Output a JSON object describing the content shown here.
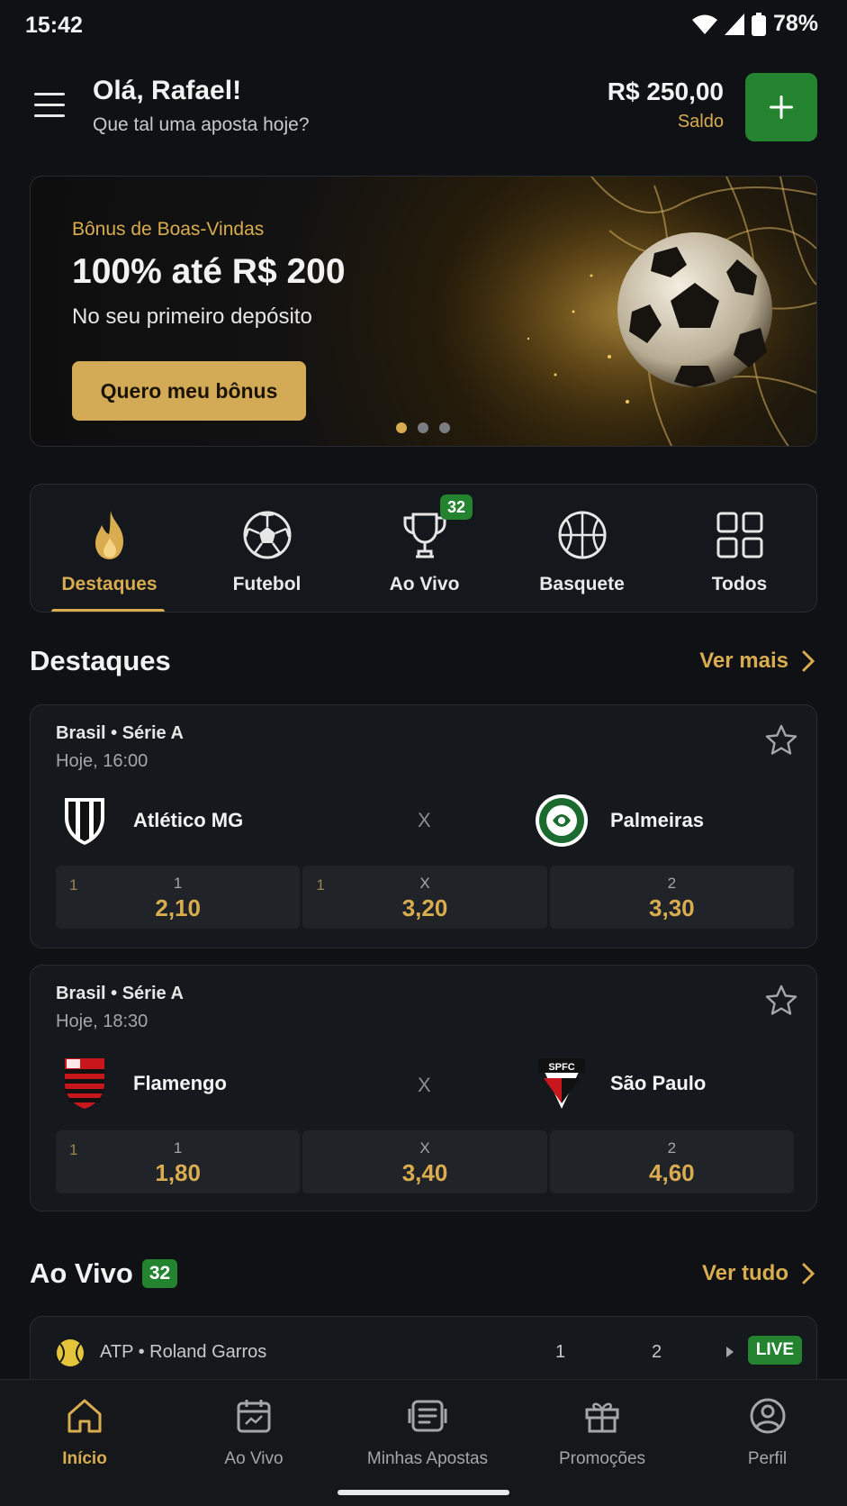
{
  "status_bar": {
    "time": "15:42",
    "battery": "78%"
  },
  "header": {
    "greeting": "Olá, Rafael!",
    "subtitle": "Que tal uma aposta hoje?",
    "balance_value": "R$ 250,00",
    "balance_label": "Saldo",
    "menu_icon": "hamburger-menu-icon",
    "deposit_icon": "plus-icon"
  },
  "banner": {
    "kicker": "Bônus de Boas-Vindas",
    "title": "100% até R$ 200",
    "subtitle": "No seu primeiro depósito",
    "cta": "Quero meu bônus",
    "slides": 3,
    "active_slide": 1
  },
  "categories": [
    {
      "label": "Destaques",
      "icon": "flame-icon",
      "active": true
    },
    {
      "label": "Futebol",
      "icon": "soccer-ball-icon",
      "active": false
    },
    {
      "label": "Ao Vivo",
      "icon": "trophy-icon",
      "active": false,
      "badge": "32"
    },
    {
      "label": "Basquete",
      "icon": "basketball-icon",
      "active": false
    },
    {
      "label": "Todos",
      "icon": "grid-icon",
      "active": false
    }
  ],
  "highlights": {
    "title": "Destaques",
    "link": "Ver mais",
    "matches": [
      {
        "league": "Brasil • Série A",
        "time": "Hoje, 16:00",
        "home": "Atlético MG",
        "away": "Palmeiras",
        "vs": "X",
        "odds": [
          {
            "label": "1",
            "value": "2,10",
            "mark": "1"
          },
          {
            "label": "X",
            "value": "3,20",
            "mark": "1"
          },
          {
            "label": "2",
            "value": "3,30",
            "mark": ""
          }
        ]
      },
      {
        "league": "Brasil • Série A",
        "time": "Hoje, 18:30",
        "home": "Flamengo",
        "away": "São Paulo",
        "vs": "X",
        "odds": [
          {
            "label": "1",
            "value": "1,80",
            "mark": "1"
          },
          {
            "label": "X",
            "value": "3,40",
            "mark": ""
          },
          {
            "label": "2",
            "value": "4,60",
            "mark": ""
          }
        ]
      }
    ]
  },
  "live": {
    "title": "Ao Vivo",
    "count": "32",
    "link": "Ver tudo",
    "preview": {
      "league": "ATP • Roland Garros",
      "set1": "1",
      "set2": "2",
      "tag": "LIVE"
    }
  },
  "bottom_nav": [
    {
      "label": "Início",
      "icon": "home-icon",
      "active": true
    },
    {
      "label": "Ao Vivo",
      "icon": "calendar-icon",
      "active": false
    },
    {
      "label": "Minhas Apostas",
      "icon": "ticket-icon",
      "active": false
    },
    {
      "label": "Promoções",
      "icon": "gift-icon",
      "active": false
    },
    {
      "label": "Perfil",
      "icon": "user-icon",
      "active": false
    }
  ],
  "colors": {
    "accent": "#d9ad4f",
    "success": "#23832f",
    "background": "#0f1114",
    "card": "#15181c"
  }
}
